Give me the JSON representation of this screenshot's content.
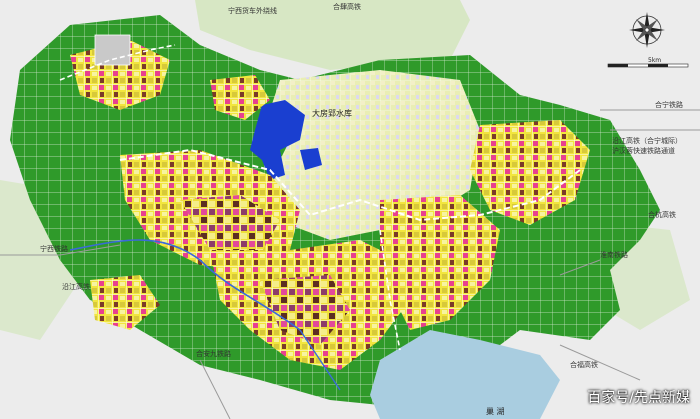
{
  "labels": {
    "railway_top": "宁西货车外绕线",
    "railway_top_right": "合肆高铁",
    "reservoir": "大房郢水库",
    "railway_hening": "合宁铁路",
    "railway_yanjiang": "沿江高铁（合宁城际）",
    "railway_huhanrong": "沪汉蓉快速铁路通道",
    "railway_hehang": "合杭高铁",
    "railway_huainan": "淮南铁路",
    "railway_ningxi": "宁西铁路",
    "railway_yanjiang_left": "沿江高铁",
    "railway_heanjiu": "合安九铁路",
    "railway_hefu": "合福高铁",
    "lake": "巢 湖"
  },
  "scale": {
    "text": "5km"
  },
  "compass": {
    "icon": "compass-rose-icon"
  },
  "watermark": "百家号/先点新媒",
  "colors": {
    "greenbelt": "#2f9a2a",
    "residential": "#f0e23a",
    "commercial": "#e23a8a",
    "industrial": "#6b3b2a",
    "water": "#1a3fd0",
    "lake": "#a9cde0",
    "background": "#ececec"
  }
}
